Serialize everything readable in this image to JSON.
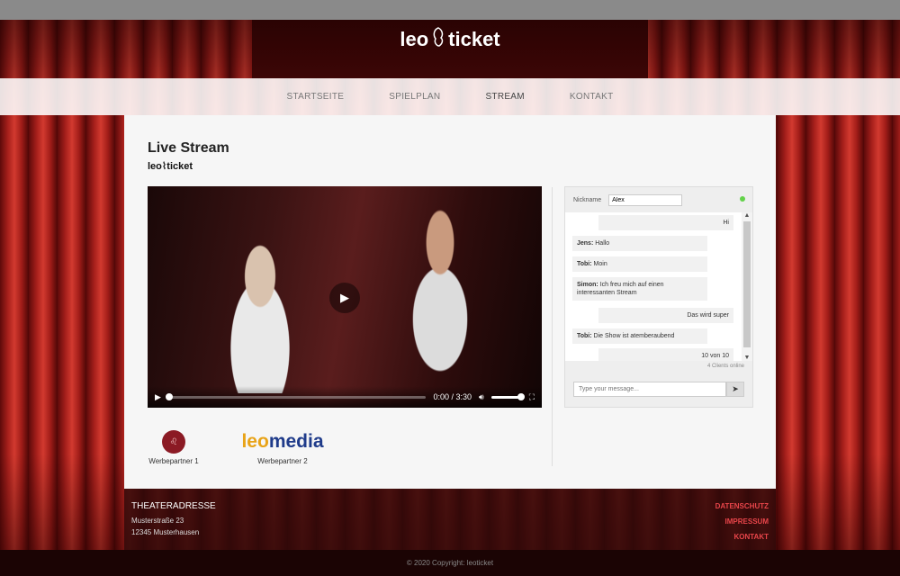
{
  "brand": {
    "logo_left": "leo",
    "logo_right": "ticket"
  },
  "nav": {
    "items": [
      {
        "label": "STARTSEITE"
      },
      {
        "label": "SPIELPLAN"
      },
      {
        "label": "STREAM"
      },
      {
        "label": "KONTAKT"
      }
    ]
  },
  "main": {
    "title": "Live Stream",
    "sub_logo_left": "leo",
    "sub_logo_right": "ticket"
  },
  "video": {
    "time": "0:00 / 3:30",
    "progress": 0.0,
    "volume": 1.0
  },
  "chat": {
    "nickname_label": "Nickname",
    "nickname_value": "Alex",
    "messages": [
      {
        "user": "",
        "text": "Hi"
      },
      {
        "user": "Jens:",
        "text": "Hallo"
      },
      {
        "user": "Tobi:",
        "text": "Moin"
      },
      {
        "user": "Simon:",
        "text": "Ich freu mich auf einen interessanten Stream"
      },
      {
        "user": "",
        "text": "Das wird super"
      },
      {
        "user": "Tobi:",
        "text": "Die Show ist atemberaubend"
      },
      {
        "user": "",
        "text": "10 von 10"
      }
    ],
    "clients_online": "4 Clients online",
    "input_placeholder": "Type your message..."
  },
  "partners": [
    {
      "label": "Werbepartner 1"
    },
    {
      "label": "Werbepartner 2",
      "brand_a": "leo",
      "brand_b": "media"
    }
  ],
  "footer": {
    "address_title": "THEATERADRESSE",
    "street": "Musterstraße 23",
    "city": "12345 Musterhausen",
    "links": [
      "DATENSCHUTZ",
      "IMPRESSUM",
      "KONTAKT"
    ],
    "copyright": "© 2020 Copyright: leoticket"
  },
  "colors": {
    "link_red": "#e8454a",
    "leo_orange": "#e8a317",
    "media_blue": "#1f3b8a",
    "online_green": "#63d24a"
  }
}
